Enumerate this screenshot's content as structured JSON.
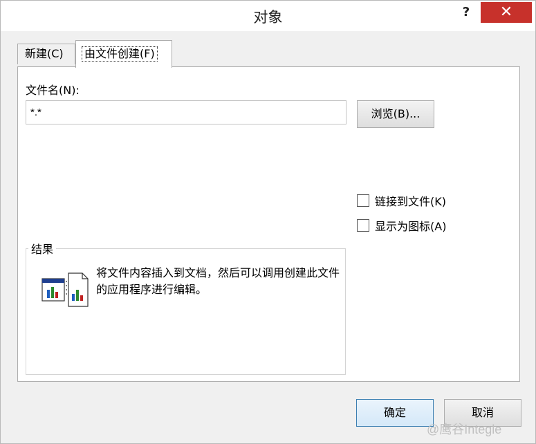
{
  "window": {
    "title": "对象",
    "help_glyph": "?",
    "close_glyph": "✕"
  },
  "tabs": [
    {
      "label": "新建(C)"
    },
    {
      "label": "由文件创建(F)"
    }
  ],
  "file_name": {
    "label": "文件名(N):",
    "value": "*.*"
  },
  "browse_button": "浏览(B)...",
  "checkboxes": {
    "link": {
      "label": "链接到文件(K)",
      "checked": false
    },
    "icon": {
      "label": "显示为图标(A)",
      "checked": false
    }
  },
  "result": {
    "title": "结果",
    "text": "将文件内容插入到文档，然后可以调用创建此文件的应用程序进行编辑。",
    "icon": "insert-object-file-icon"
  },
  "footer": {
    "ok_label": "确定",
    "cancel_label": "取消"
  },
  "watermark": "@鹰谷Integle"
}
